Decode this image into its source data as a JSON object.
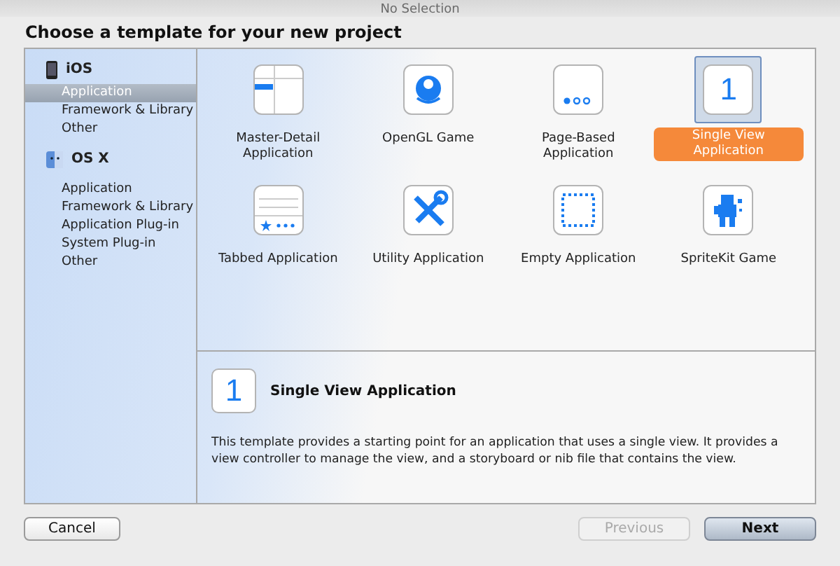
{
  "toolbar": {
    "text": "No Selection"
  },
  "title": "Choose a template for your new project",
  "sidebar": {
    "groups": [
      {
        "label": "iOS",
        "kind": "phone",
        "items": [
          {
            "label": "Application",
            "selected": true
          },
          {
            "label": "Framework & Library",
            "selected": false
          },
          {
            "label": "Other",
            "selected": false
          }
        ]
      },
      {
        "label": "OS X",
        "kind": "mac",
        "items": [
          {
            "label": "Application",
            "selected": false
          },
          {
            "label": "Framework & Library",
            "selected": false
          },
          {
            "label": "Application Plug-in",
            "selected": false
          },
          {
            "label": "System Plug-in",
            "selected": false
          },
          {
            "label": "Other",
            "selected": false
          }
        ]
      }
    ]
  },
  "templates": [
    {
      "label": "Master-Detail Application",
      "kind": "master-detail",
      "selected": false
    },
    {
      "label": "OpenGL Game",
      "kind": "opengl",
      "selected": false
    },
    {
      "label": "Page-Based Application",
      "kind": "page-based",
      "selected": false
    },
    {
      "label": "Single View Application",
      "kind": "single-view",
      "glyph": "1",
      "selected": true
    },
    {
      "label": "Tabbed Application",
      "kind": "tabbed",
      "selected": false
    },
    {
      "label": "Utility Application",
      "kind": "utility",
      "selected": false
    },
    {
      "label": "Empty Application",
      "kind": "empty",
      "selected": false
    },
    {
      "label": "SpriteKit Game",
      "kind": "spritekit",
      "selected": false
    }
  ],
  "detail": {
    "glyph": "1",
    "title": "Single View Application",
    "description": "This template provides a starting point for an application that uses a single view. It provides a view controller to manage the view, and a storyboard or nib file that contains the view."
  },
  "buttons": [
    {
      "label": "Cancel",
      "kind": "cancel",
      "disabled": false
    },
    {
      "label": "Previous",
      "kind": "previous",
      "disabled": true
    },
    {
      "label": "Next",
      "kind": "next",
      "disabled": false
    }
  ]
}
